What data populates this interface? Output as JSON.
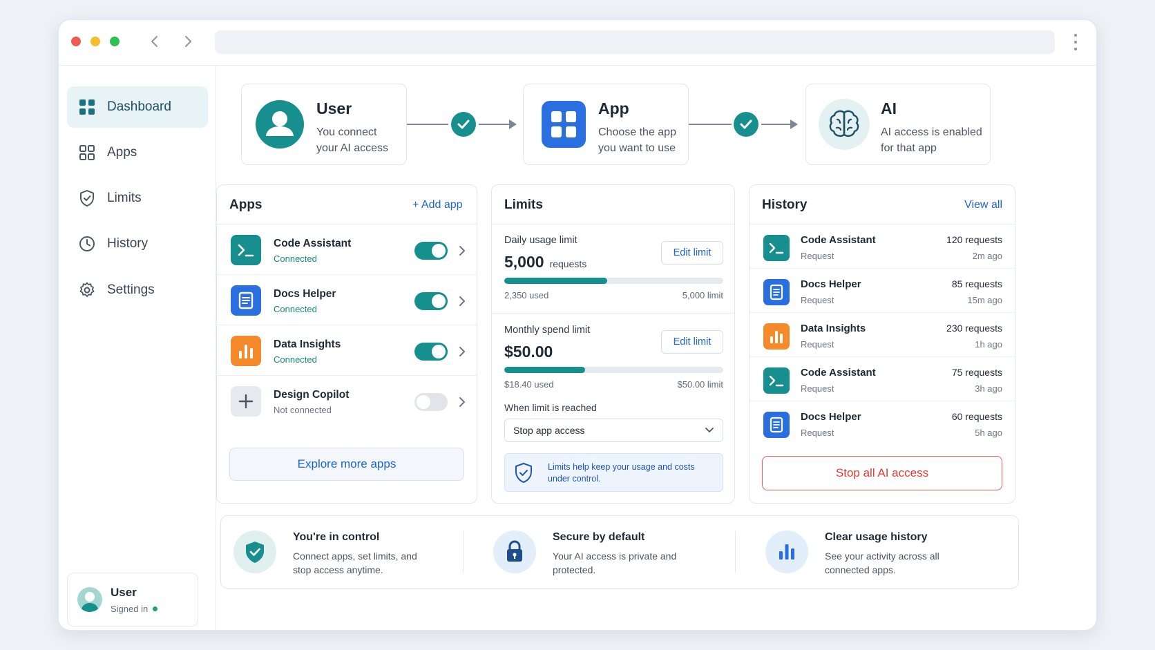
{
  "sidebar": {
    "items": [
      {
        "label": "Dashboard",
        "icon": "grid-icon"
      },
      {
        "label": "Apps",
        "icon": "apps-icon"
      },
      {
        "label": "Limits",
        "icon": "shield-icon"
      },
      {
        "label": "History",
        "icon": "clock-icon"
      },
      {
        "label": "Settings",
        "icon": "gear-icon"
      }
    ],
    "user": {
      "name": "User",
      "status": "Signed in"
    }
  },
  "flow": {
    "user": {
      "title": "User",
      "desc": "You connect your AI access"
    },
    "app": {
      "title": "App",
      "desc": "Choose the app you want to use"
    },
    "ai": {
      "title": "AI",
      "desc": "AI access is enabled for that app"
    }
  },
  "apps": {
    "title": "Apps",
    "add_label": "+ Add app",
    "rows": [
      {
        "name": "Code Assistant",
        "status": "Connected",
        "enabled": true
      },
      {
        "name": "Docs Helper",
        "status": "Connected",
        "enabled": true
      },
      {
        "name": "Data Insights",
        "status": "Connected",
        "enabled": true
      },
      {
        "name": "Design Copilot",
        "status": "Not connected",
        "enabled": false
      }
    ],
    "explore_label": "Explore more apps"
  },
  "limits": {
    "title": "Limits",
    "daily": {
      "label": "Daily usage limit",
      "value": "5,000",
      "unit": "requests",
      "edit": "Edit limit",
      "used": "2,350 used",
      "limit": "5,000 limit",
      "progress": 0.47
    },
    "monthly": {
      "label": "Monthly spend limit",
      "value": "$50.00",
      "edit": "Edit limit",
      "used": "$18.40 used",
      "limit": "$50.00 limit",
      "progress": 0.368
    },
    "when_label": "When limit is reached",
    "action_value": "Stop app access",
    "note": "Limits help keep your usage and costs under control."
  },
  "history": {
    "title": "History",
    "view_all": "View all",
    "rows": [
      {
        "name": "Code Assistant",
        "type": "Request",
        "count": "120 requests",
        "time": "2m ago"
      },
      {
        "name": "Docs Helper",
        "type": "Request",
        "count": "85 requests",
        "time": "15m ago"
      },
      {
        "name": "Data Insights",
        "type": "Request",
        "count": "230 requests",
        "time": "1h ago"
      },
      {
        "name": "Code Assistant",
        "type": "Request",
        "count": "75 requests",
        "time": "3h ago"
      },
      {
        "name": "Docs Helper",
        "type": "Request",
        "count": "60 requests",
        "time": "5h ago"
      }
    ],
    "stop_label": "Stop all AI access"
  },
  "features": [
    {
      "title": "You're in control",
      "desc": "Connect apps, set limits, and stop access anytime."
    },
    {
      "title": "Secure by default",
      "desc": "Your AI access is private and protected."
    },
    {
      "title": "Clear usage history",
      "desc": "See your activity across all connected apps."
    }
  ],
  "colors": {
    "accent": "#168f8f",
    "link": "#1d63d8",
    "danger": "#e13b32",
    "orange": "#f58a2a",
    "blue": "#2a6fe0"
  }
}
